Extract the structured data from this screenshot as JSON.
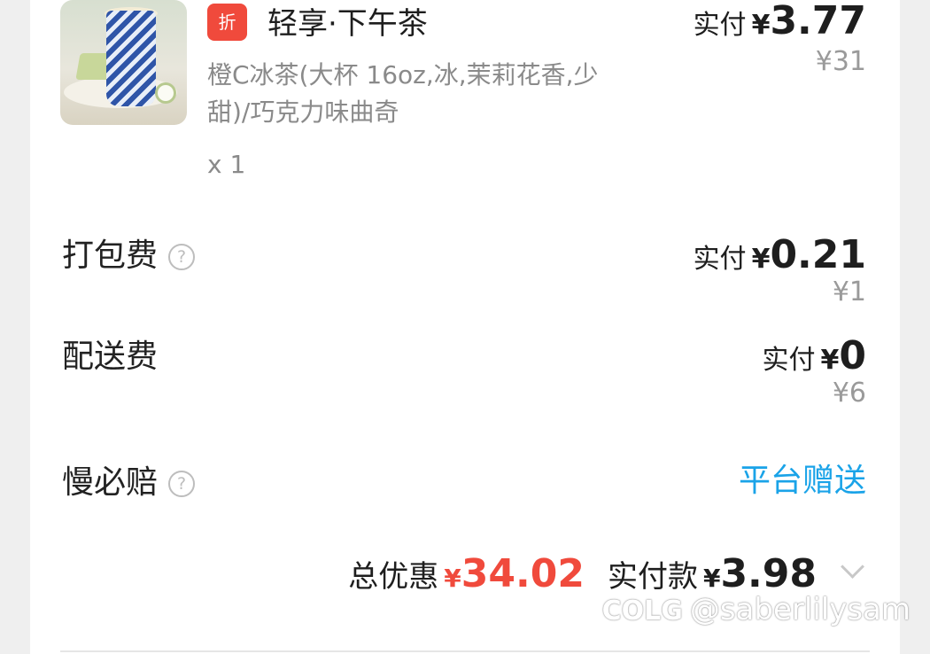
{
  "product": {
    "badge": "折",
    "name": "轻享·下午茶",
    "spec": "橙C冰茶(大杯 16oz,冰,茉莉花香,少甜)/巧克力味曲奇",
    "quantity": "x 1",
    "pay_label": "实付",
    "currency": "¥",
    "pay_amount": "3.77",
    "original_price": "¥31"
  },
  "packing_fee": {
    "label": "打包费",
    "help_icon": "?",
    "pay_label": "实付",
    "currency": "¥",
    "pay_amount": "0.21",
    "original_price": "¥1"
  },
  "delivery_fee": {
    "label": "配送费",
    "pay_label": "实付",
    "currency": "¥",
    "pay_amount": "0",
    "original_price": "¥6"
  },
  "late_compensation": {
    "label": "慢必赔",
    "help_icon": "?",
    "value": "平台赠送"
  },
  "summary": {
    "discount_label": "总优惠",
    "discount_currency": "¥",
    "discount_amount": "34.02",
    "total_label": "实付款",
    "total_currency": "¥",
    "total_amount": "3.98"
  },
  "watermark": {
    "logo": "COLG",
    "handle": "@saberlilysam"
  },
  "colors": {
    "accent_red": "#f04a3c",
    "link_blue": "#1aa3e8"
  }
}
